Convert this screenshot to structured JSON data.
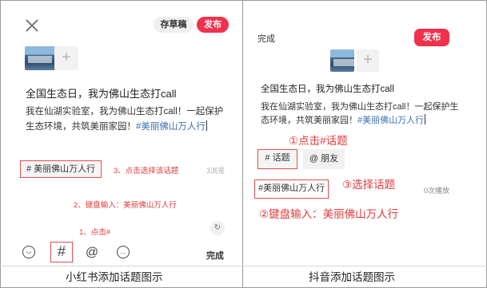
{
  "xiaohongshu": {
    "close_icon": "close-icon",
    "save_draft": "存草稿",
    "publish": "发布",
    "add_symbol": "+",
    "title": "全国生态日，我为佛山生态打call",
    "body_text": "我在仙湖实验室，我为佛山生态打call！一起保护生态环境，共筑美丽家园！",
    "body_hashtag": "#美丽佛山万人行",
    "topic_tag": "# 美丽佛山万人行",
    "step3_note": "3、点击选择该话题",
    "views": "3浏览",
    "step2_note": "2、键盘输入：美丽佛山万人行",
    "step1_note": "1、点击#",
    "toolbar": {
      "emoji_icon": "emoji-icon",
      "hash_label": "#",
      "at_label": "@",
      "comment_icon": "comment-icon",
      "done": "完成"
    },
    "caption": "小红书添加话题图示"
  },
  "douyin": {
    "done": "完成",
    "publish": "发布",
    "add_symbol": "+",
    "title": "全国生态日，我为佛山生态打call",
    "body_text": "我在仙湖实验室，我为佛山生态打call！一起保护生态环境，共筑美丽家园！",
    "body_hashtag": "#美丽佛山万人行",
    "step1_note": "①点击#话题",
    "topic_button": "# 话题",
    "friends_button": "@ 朋友",
    "step3_note": "③选择话题",
    "topic_tag": "#美丽佛山万人行",
    "plays": "0次播放",
    "step2_note": "②键盘输入：美丽佛山万人行",
    "caption": "抖音添加话题图示"
  },
  "colors": {
    "accent_red": "#f0314d",
    "annotation_red": "#e23a3a",
    "hashtag_blue": "#3d6fb3"
  }
}
